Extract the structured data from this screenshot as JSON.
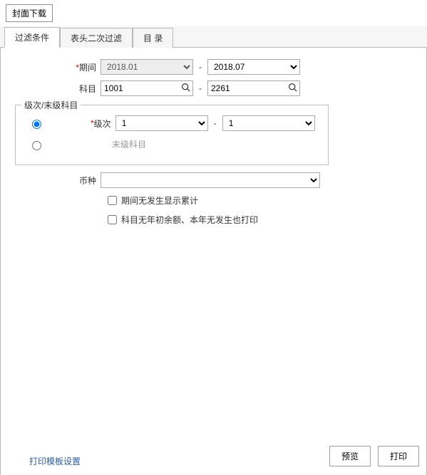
{
  "toolbar": {
    "cover_download": "封面下载"
  },
  "tabs": {
    "filter": "过滤条件",
    "header_filter": "表头二次过滤",
    "toc": "目 录"
  },
  "form": {
    "period_label": "期间",
    "period_from": "2018.01",
    "period_to": "2018.07",
    "subject_label": "科目",
    "subject_from": "1001",
    "subject_to": "2261",
    "level_group_legend": "级次/末级科目",
    "level_label": "级次",
    "level_from": "1",
    "level_to": "1",
    "leaf_label": "末级科目",
    "currency_label": "币种",
    "currency_value": "",
    "chk_show_cumulative": "期间无发生显示累计",
    "chk_print_no_balance": "科目无年初余额、本年无发生也打印"
  },
  "footer": {
    "template_setting": "打印模板设置",
    "preview": "预览",
    "print": "打印"
  }
}
